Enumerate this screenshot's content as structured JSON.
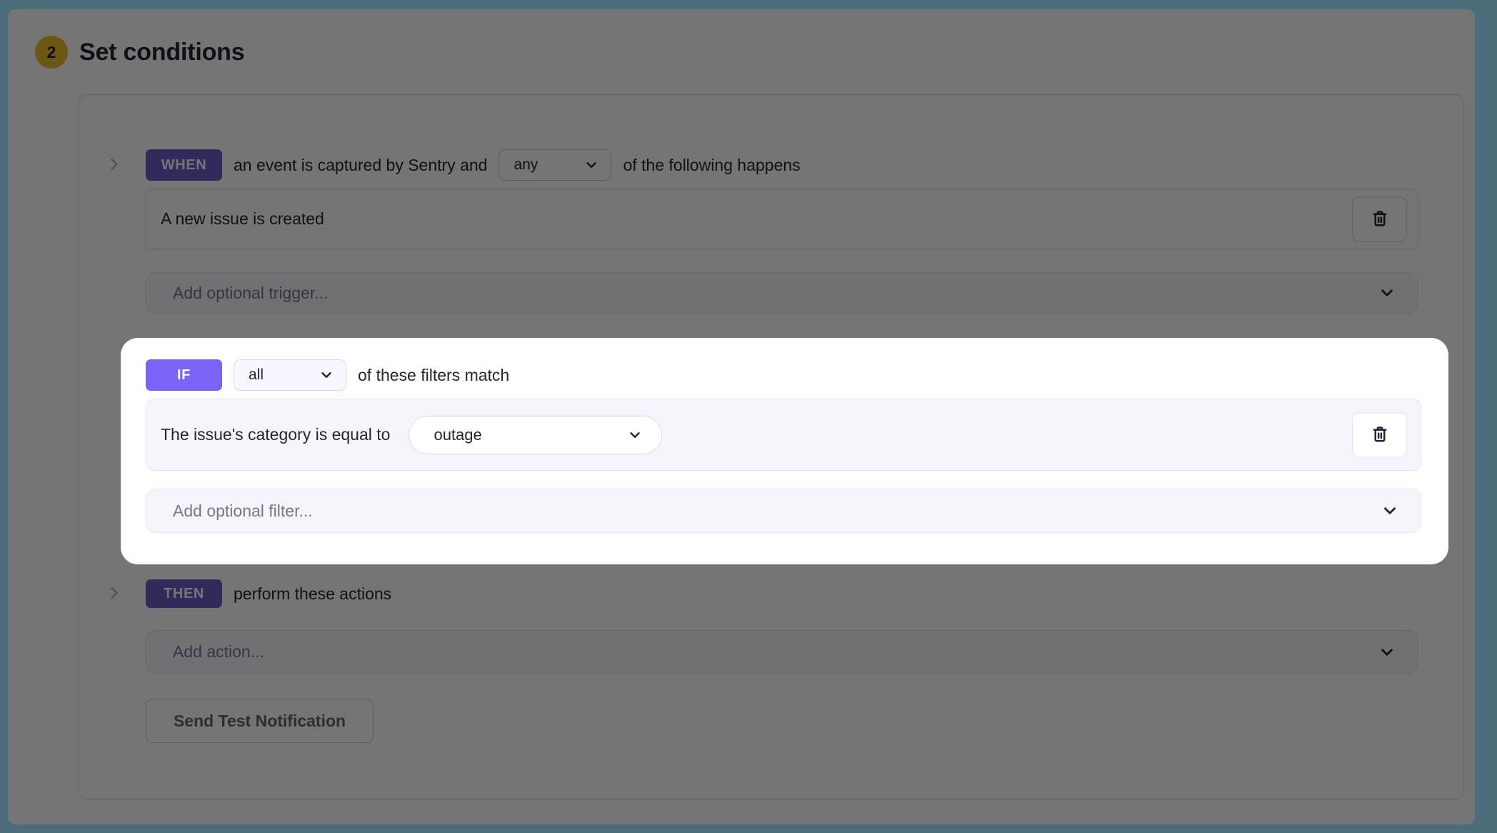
{
  "window": {
    "frame_color": "#4C6E7C",
    "overlay_color": "rgba(0,0,0,0.54)"
  },
  "colors": {
    "accent_purple": "#6C5FC7",
    "highlight_purple": "#7A63F6",
    "step_yellow": "#E8BE25",
    "text_dark": "#2B2233"
  },
  "header": {
    "step_number": "2",
    "title": "Set conditions"
  },
  "when": {
    "badge": "WHEN",
    "text_before_select": "an event is captured by Sentry and",
    "select_value": "any",
    "text_after_select": "of the following happens",
    "condition_row": "A new issue is created",
    "add_placeholder": "Add optional trigger..."
  },
  "if": {
    "badge": "IF",
    "select_value": "all",
    "text_after_select": "of these filters match",
    "filter_label": "The issue's category is equal to",
    "filter_select_value": "outage",
    "add_placeholder": "Add optional filter..."
  },
  "then": {
    "badge": "THEN",
    "text_after_badge": "perform these actions",
    "add_placeholder": "Add action...",
    "send_test_button": "Send Test Notification"
  },
  "icons": {
    "trash": "trash-icon",
    "chevron_down": "chevron-down-icon",
    "chevron_right": "chevron-right-icon"
  }
}
